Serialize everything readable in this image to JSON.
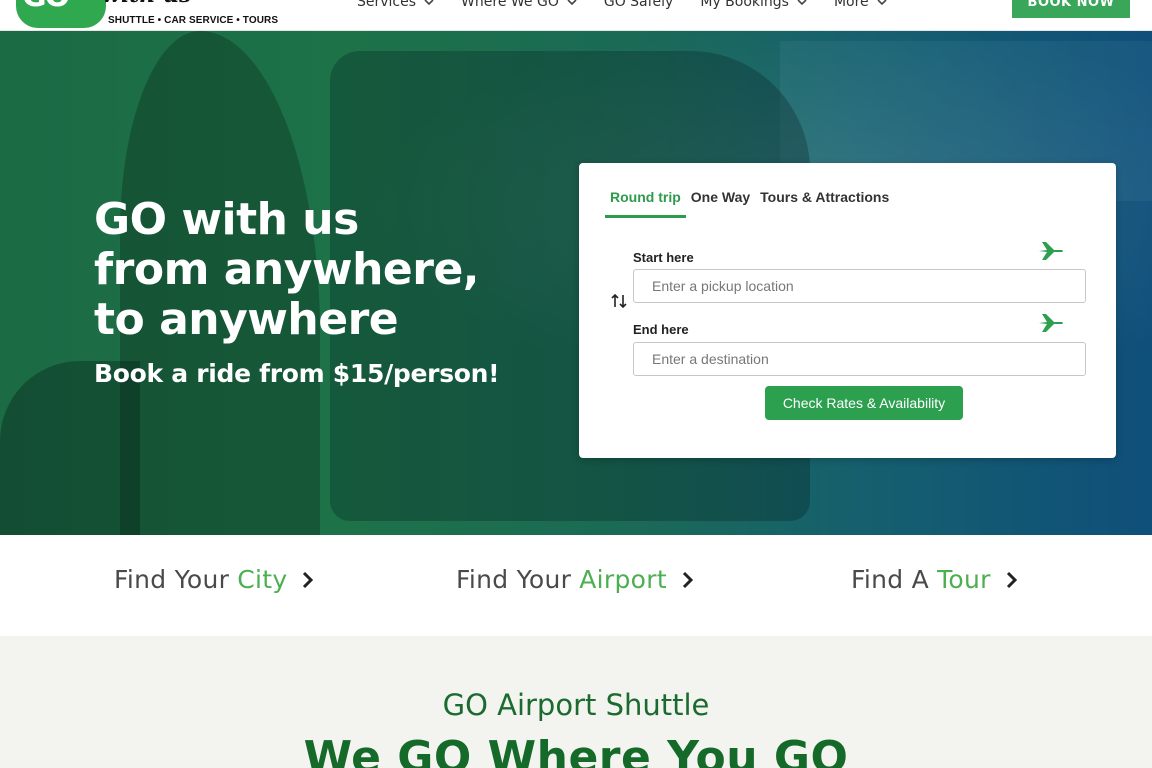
{
  "brand": {
    "logo_text": "GO",
    "logo_script": "with us",
    "tagline": "SHUTTLE • CAR SERVICE • TOURS",
    "primary_color": "#2fa84f",
    "dark_green": "#156a2a"
  },
  "nav": {
    "items": [
      {
        "label": "Services",
        "has_dropdown": true
      },
      {
        "label": "Where We GO",
        "has_dropdown": true
      },
      {
        "label": "GO Safely",
        "has_dropdown": false
      },
      {
        "label": "My Bookings",
        "has_dropdown": true
      },
      {
        "label": "More",
        "has_dropdown": true
      }
    ],
    "book_now": "BOOK NOW"
  },
  "hero": {
    "title_lines": [
      "GO with us",
      "from anywhere,",
      "to anywhere"
    ],
    "subtitle": "Book a ride from $15/person!"
  },
  "booking": {
    "tabs": [
      {
        "label": "Round trip",
        "active": true
      },
      {
        "label": "One Way",
        "active": false
      },
      {
        "label": "Tours & Attractions",
        "active": false
      }
    ],
    "start_label": "Start here",
    "start_placeholder": "Enter a pickup location",
    "end_label": "End here",
    "end_placeholder": "Enter a destination",
    "submit_label": "Check Rates & Availability",
    "icons": [
      "airplane-icon",
      "swap-icon"
    ]
  },
  "find": [
    {
      "prefix": "Find Your",
      "highlight": "City"
    },
    {
      "prefix": "Find Your",
      "highlight": "Airport"
    },
    {
      "prefix": "Find A",
      "highlight": "Tour"
    }
  ],
  "section": {
    "kicker": "GO Airport Shuttle",
    "heading": "We GO Where You GO"
  }
}
